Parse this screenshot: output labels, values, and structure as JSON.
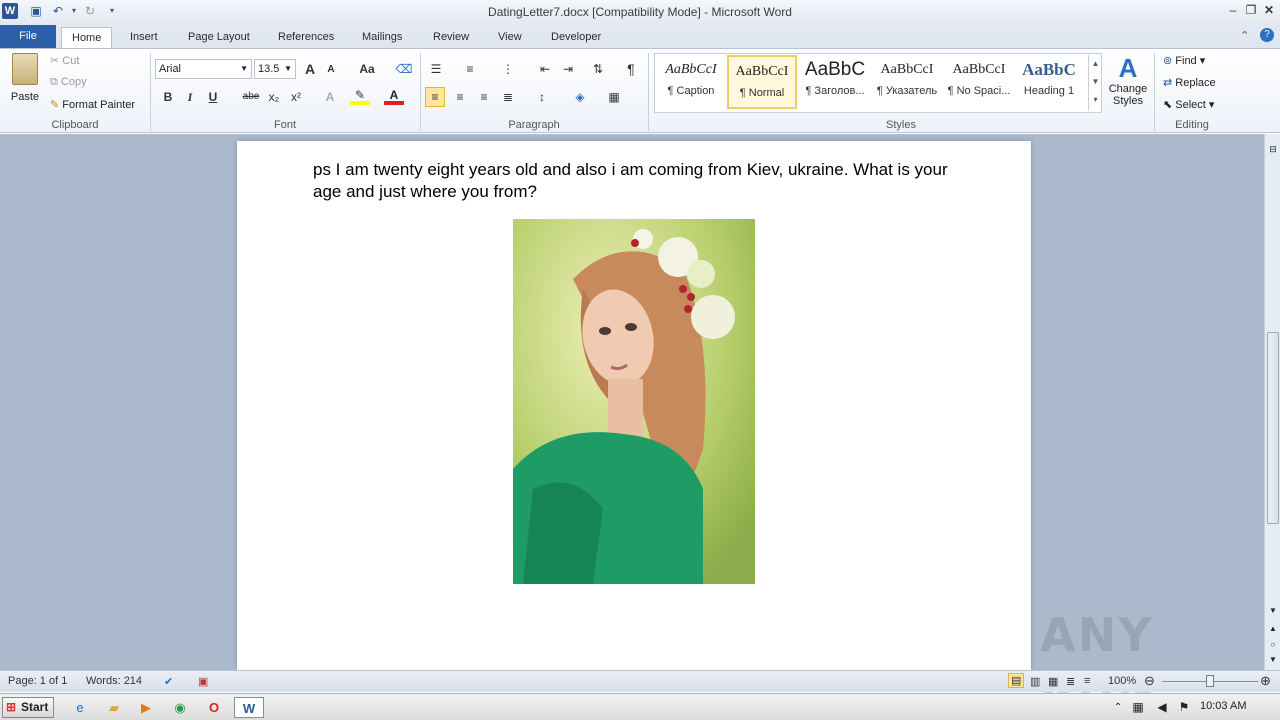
{
  "window": {
    "title": "DatingLetter7.docx [Compatibility Mode] - Microsoft Word"
  },
  "tabs": [
    "File",
    "Home",
    "Insert",
    "Page Layout",
    "References",
    "Mailings",
    "Review",
    "View",
    "Developer"
  ],
  "clipboard": {
    "paste": "Paste",
    "cut": "Cut",
    "copy": "Copy",
    "format_painter": "Format Painter",
    "label": "Clipboard"
  },
  "font": {
    "name": "Arial",
    "size": "13.5",
    "label": "Font",
    "bold": "B",
    "italic": "I",
    "underline": "U",
    "strike": "abe",
    "subscript": "x₂",
    "superscript": "x²",
    "grow": "A",
    "shrink": "A",
    "change_case": "Aa"
  },
  "paragraph": {
    "label": "Paragraph",
    "pilcrow": "¶"
  },
  "styles": {
    "label": "Styles",
    "items": [
      {
        "sample": "AaBbCcI",
        "name": "¶ Caption"
      },
      {
        "sample": "AaBbCcI",
        "name": "¶ Normal"
      },
      {
        "sample": "AaBbC",
        "name": "¶ Заголов..."
      },
      {
        "sample": "AaBbCcI",
        "name": "¶ Указатель"
      },
      {
        "sample": "AaBbCcI",
        "name": "¶ No Spaci..."
      },
      {
        "sample": "AaBbC",
        "name": "Heading 1"
      }
    ],
    "change_styles": "Change",
    "change_styles2": "Styles"
  },
  "editing": {
    "label": "Editing",
    "find": "Find",
    "replace": "Replace",
    "select": "Select"
  },
  "document": {
    "text": "ps I am twenty eight years old and also i am coming from Kiev, ukraine. What is your age and just where you from?"
  },
  "status": {
    "page": "Page: 1 of 1",
    "words": "Words: 214",
    "zoom": "100%"
  },
  "taskbar": {
    "start": "Start",
    "clock": "10:03 AM"
  },
  "watermark": "ANY RUN"
}
